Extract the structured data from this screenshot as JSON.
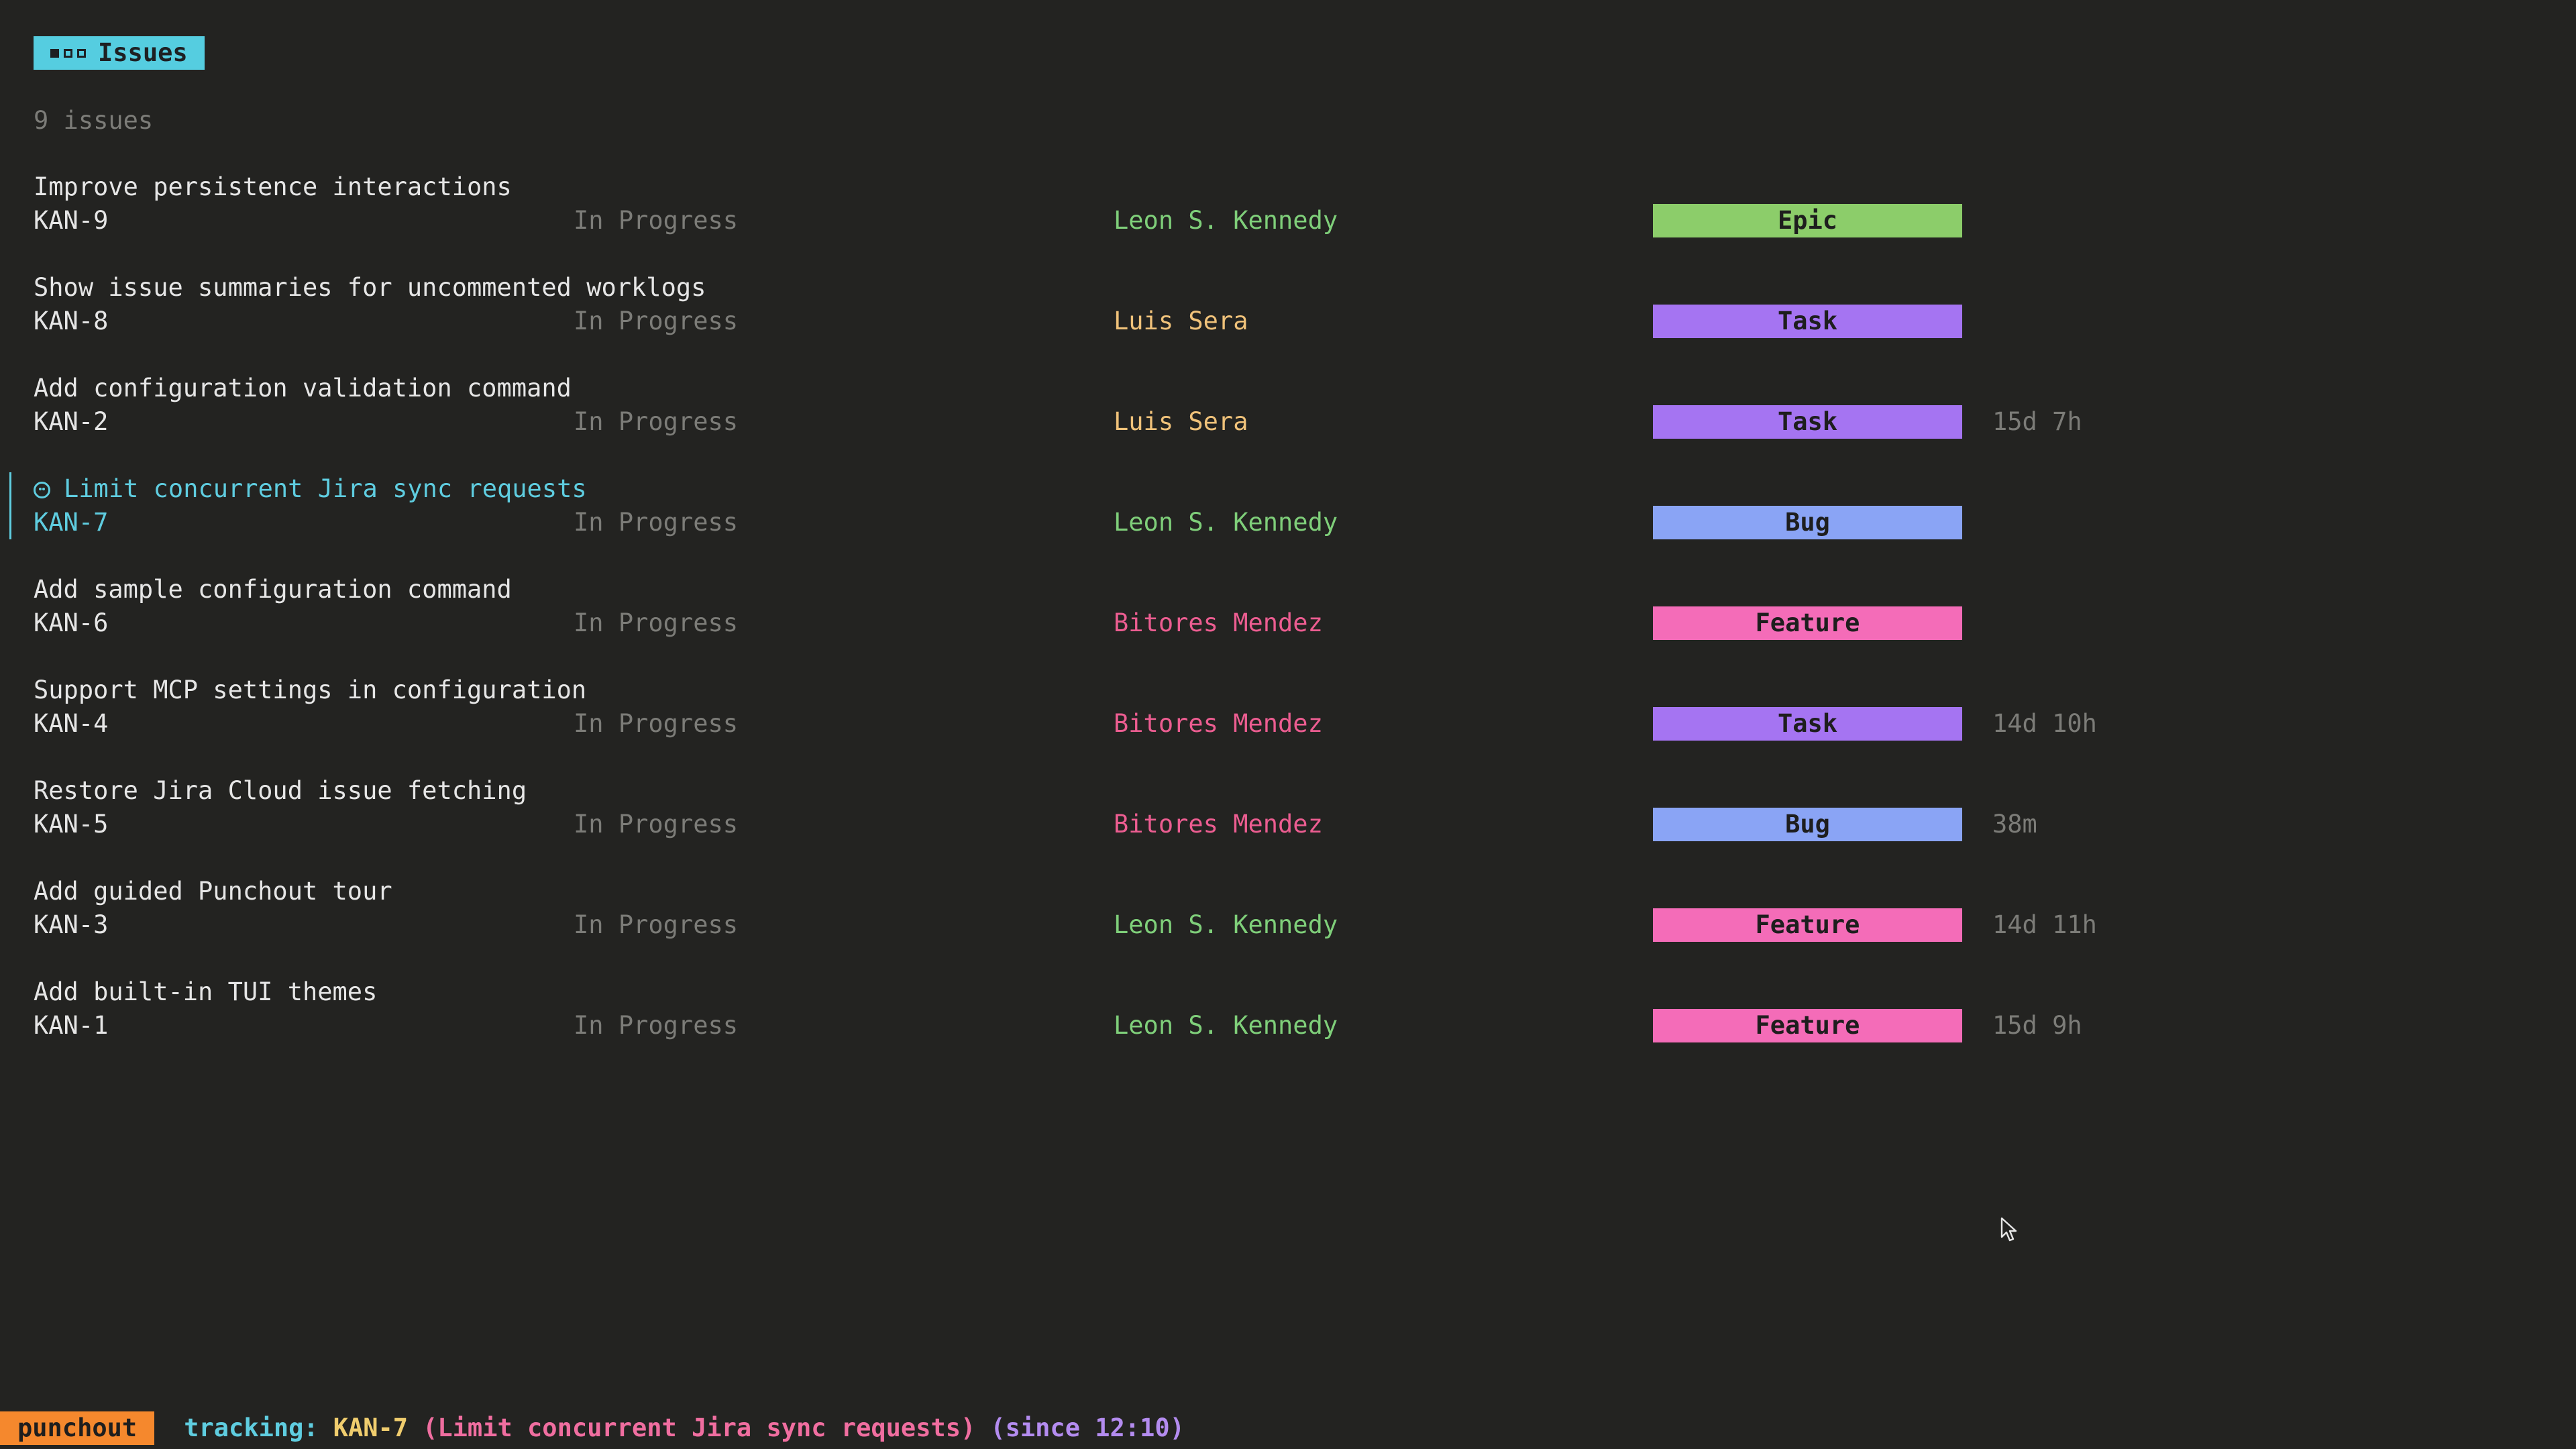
{
  "header": {
    "title": "Issues",
    "count_text": "9 issues"
  },
  "colors": {
    "background": "#232321",
    "accent": "#55cde0",
    "muted": "#7c7c78",
    "assignee_leon": "#7fcf7a",
    "assignee_luis": "#f0c27a",
    "assignee_bitores": "#ec5d91",
    "type_epic": "#8ccd6a",
    "type_task": "#a574f2",
    "type_bug": "#8aa4f5",
    "type_feature": "#f46cb8"
  },
  "issues": [
    {
      "title": "Improve persistence interactions",
      "key": "KAN-9",
      "status": "In Progress",
      "assignee": "Leon S. Kennedy",
      "assignee_color": "#7fcf7a",
      "type": "Epic",
      "type_color": "#8ccd6a",
      "duration": ""
    },
    {
      "title": "Show issue summaries for uncommented worklogs",
      "key": "KAN-8",
      "status": "In Progress",
      "assignee": "Luis Sera",
      "assignee_color": "#f0c27a",
      "type": "Task",
      "type_color": "#a574f2",
      "duration": ""
    },
    {
      "title": "Add configuration validation command",
      "key": "KAN-2",
      "status": "In Progress",
      "assignee": "Luis Sera",
      "assignee_color": "#f0c27a",
      "type": "Task",
      "type_color": "#a574f2",
      "duration": "15d 7h"
    },
    {
      "title": "Limit concurrent Jira sync requests",
      "key": "KAN-7",
      "status": "In Progress",
      "assignee": "Leon S. Kennedy",
      "assignee_color": "#7fcf7a",
      "type": "Bug",
      "type_color": "#8aa4f5",
      "duration": "",
      "selected": true,
      "icon": "tracking-face-icon"
    },
    {
      "title": "Add sample configuration command",
      "key": "KAN-6",
      "status": "In Progress",
      "assignee": "Bitores Mendez",
      "assignee_color": "#ec5d91",
      "type": "Feature",
      "type_color": "#f46cb8",
      "duration": ""
    },
    {
      "title": "Support MCP settings in configuration",
      "key": "KAN-4",
      "status": "In Progress",
      "assignee": "Bitores Mendez",
      "assignee_color": "#ec5d91",
      "type": "Task",
      "type_color": "#a574f2",
      "duration": "14d 10h"
    },
    {
      "title": "Restore Jira Cloud issue fetching",
      "key": "KAN-5",
      "status": "In Progress",
      "assignee": "Bitores Mendez",
      "assignee_color": "#ec5d91",
      "type": "Bug",
      "type_color": "#8aa4f5",
      "duration": "38m"
    },
    {
      "title": "Add guided Punchout tour",
      "key": "KAN-3",
      "status": "In Progress",
      "assignee": "Leon S. Kennedy",
      "assignee_color": "#7fcf7a",
      "type": "Feature",
      "type_color": "#f46cb8",
      "duration": "14d 11h"
    },
    {
      "title": "Add built-in TUI themes",
      "key": "KAN-1",
      "status": "In Progress",
      "assignee": "Leon S. Kennedy",
      "assignee_color": "#7fcf7a",
      "type": "Feature",
      "type_color": "#f46cb8",
      "duration": "15d 9h"
    }
  ],
  "status_bar": {
    "app_name": "punchout",
    "tracking_label": "tracking:",
    "tracking_key": "KAN-7",
    "tracking_summary": "(Limit concurrent Jira sync requests)",
    "tracking_since": "(since 12:10)"
  }
}
